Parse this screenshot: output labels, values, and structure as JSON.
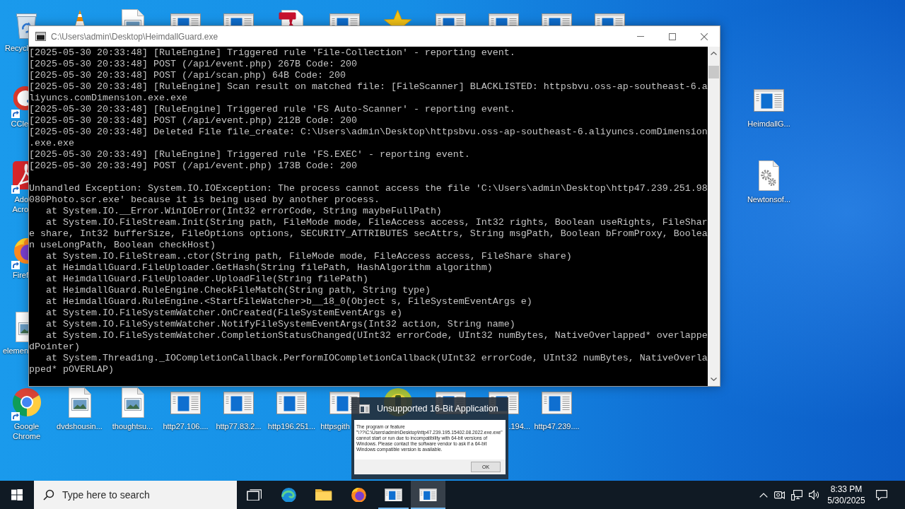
{
  "desktop": {
    "left_column": [
      {
        "kind": "recycle-bin",
        "label": "Recycl",
        "shortcut": false
      },
      {
        "kind": "ccleaner",
        "label": "CCle",
        "shortcut": true
      },
      {
        "kind": "acrobat",
        "label": "Ado Acro",
        "shortcut": true
      },
      {
        "kind": "firefox",
        "label": "Firef",
        "shortcut": true
      },
      {
        "kind": "image-file",
        "label": "elemen",
        "shortcut": false
      }
    ],
    "top_row": [
      {
        "kind": "cone"
      },
      {
        "kind": "image-file"
      },
      {
        "kind": "app"
      },
      {
        "kind": "app"
      },
      {
        "kind": "pdf"
      },
      {
        "kind": "app"
      },
      {
        "kind": "star"
      },
      {
        "kind": "app"
      },
      {
        "kind": "app"
      },
      {
        "kind": "app"
      },
      {
        "kind": "app"
      }
    ],
    "right_column": [
      {
        "kind": "app",
        "label": "HeimdallG..."
      },
      {
        "kind": "settings-file",
        "label": "Newtonsof..."
      }
    ],
    "bottom_row": [
      {
        "kind": "chrome",
        "label": "Google Chrome",
        "shortcut": true
      },
      {
        "kind": "image-file",
        "label": "dvdshousin...",
        "shortcut": false
      },
      {
        "kind": "image-file",
        "label": "thoughtsu...",
        "shortcut": false
      },
      {
        "kind": "app",
        "label": "http27.106....",
        "shortcut": false
      },
      {
        "kind": "app",
        "label": "http77.83.2...",
        "shortcut": false
      },
      {
        "kind": "app",
        "label": "http196.251...",
        "shortcut": false
      },
      {
        "kind": "app",
        "label": "httpsgith",
        "shortcut": false
      },
      {
        "kind": "green-app",
        "shortcut": false
      },
      {
        "kind": "app",
        "shortcut": false
      },
      {
        "kind": "app",
        "label": ".194...",
        "shortcut": false
      },
      {
        "kind": "app",
        "label": "http47.239....",
        "shortcut": false
      }
    ]
  },
  "console_window": {
    "title": "C:\\Users\\admin\\Desktop\\HeimdallGuard.exe",
    "blocks": [
      {
        "lines": [
          {
            "kind": "text",
            "text": "[2025-05-30 20:33:48] [RuleEngine] Triggered rule 'File-Collection' - reporting event."
          },
          {
            "kind": "text",
            "text": "[2025-05-30 20:33:48] POST (/api/event.php) 267B Code: 200"
          },
          {
            "kind": "text",
            "text": "[2025-05-30 20:33:48] POST (/api/scan.php) 64B Code: 200"
          },
          {
            "kind": "text",
            "text": "[2025-05-30 20:33:48] [RuleEngine] Scan result on matched file: [FileScanner] BLACKLISTED: httpsbvu.oss-ap-southeast-6.a"
          },
          {
            "kind": "text",
            "text": "liyuncs.comDimension.exe.exe"
          },
          {
            "kind": "text",
            "text": "[2025-05-30 20:33:48] [RuleEngine] Triggered rule 'FS Auto-Scanner' - reporting event."
          },
          {
            "kind": "text",
            "text": "[2025-05-30 20:33:48] POST (/api/event.php) 212B Code: 200"
          },
          {
            "kind": "text",
            "text": "[2025-05-30 20:33:48] Deleted File file_create: C:\\Users\\admin\\Desktop\\httpsbvu.oss-ap-southeast-6.aliyuncs.comDimension"
          },
          {
            "kind": "text",
            "text": ".exe.exe"
          },
          {
            "kind": "text",
            "text": "[2025-05-30 20:33:49] [RuleEngine] Triggered rule 'FS.EXEC' - reporting event."
          },
          {
            "kind": "text",
            "text": "[2025-05-30 20:33:49] POST (/api/event.php) 173B Code: 200"
          }
        ]
      },
      {
        "lines": [
          {
            "kind": "text",
            "text": "Unhandled Exception: System.IO.IOException: The process cannot access the file 'C:\\Users\\admin\\Desktop\\http47.239.251.98"
          },
          {
            "kind": "text",
            "text": "080Photo.scr.exe' because it is being used by another process."
          },
          {
            "kind": "frame",
            "text": "at System.IO.__Error.WinIOError(Int32 errorCode, String maybeFullPath)"
          },
          {
            "kind": "frame",
            "text": "at System.IO.FileStream.Init(String path, FileMode mode, FileAccess access, Int32 rights, Boolean useRights, FileShar"
          },
          {
            "kind": "text",
            "text": "e share, Int32 bufferSize, FileOptions options, SECURITY_ATTRIBUTES secAttrs, String msgPath, Boolean bFromProxy, Boolea"
          },
          {
            "kind": "text",
            "text": "n useLongPath, Boolean checkHost)"
          },
          {
            "kind": "frame",
            "text": "at System.IO.FileStream..ctor(String path, FileMode mode, FileAccess access, FileShare share)"
          },
          {
            "kind": "frame",
            "text": "at HeimdallGuard.FileUploader.GetHash(String filePath, HashAlgorithm algorithm)"
          },
          {
            "kind": "frame",
            "text": "at HeimdallGuard.FileUploader.UploadFile(String filePath)"
          },
          {
            "kind": "frame",
            "text": "at HeimdallGuard.RuleEngine.CheckFileMatch(String path, String type)"
          },
          {
            "kind": "frame",
            "text": "at HeimdallGuard.RuleEngine.<StartFileWatcher>b__18_0(Object s, FileSystemEventArgs e)"
          },
          {
            "kind": "frame",
            "text": "at System.IO.FileSystemWatcher.OnCreated(FileSystemEventArgs e)"
          },
          {
            "kind": "frame",
            "text": "at System.IO.FileSystemWatcher.NotifyFileSystemEventArgs(Int32 action, String name)"
          },
          {
            "kind": "frame",
            "text": "at System.IO.FileSystemWatcher.CompletionStatusChanged(UInt32 errorCode, UInt32 numBytes, NativeOverlapped* overlappe"
          },
          {
            "kind": "text",
            "text": "dPointer)"
          },
          {
            "kind": "frame",
            "text": "at System.Threading._IOCompletionCallback.PerformIOCompletionCallback(UInt32 errorCode, UInt32 numBytes, NativeOverla"
          },
          {
            "kind": "text",
            "text": "pped* pOVERLAP)"
          }
        ]
      }
    ]
  },
  "window_preview": {
    "title": "Unsupported 16-Bit Application",
    "message": "The program or feature\n\"\\??\\C:\\Users\\admin\\Desktop\\http47.239.195.15402.08.2022.exe.exe\"\ncannot start or run due to incompatibility with 64-bit versions of\nWindows. Please contact the software vendor to ask if a 64-bit\nWindows compatible version is available.",
    "button": "OK"
  },
  "taskbar": {
    "search": {
      "placeholder": "Type here to search"
    },
    "apps": [
      {
        "kind": "task-view",
        "running": false,
        "selected": false
      },
      {
        "kind": "edge",
        "running": false,
        "selected": false
      },
      {
        "kind": "explorer",
        "running": false,
        "selected": false
      },
      {
        "kind": "firefox",
        "running": false,
        "selected": false
      },
      {
        "kind": "app",
        "running": true,
        "selected": false
      },
      {
        "kind": "app",
        "running": true,
        "selected": true
      }
    ],
    "clock": {
      "time": "8:33 PM",
      "date": "5/30/2025"
    }
  }
}
